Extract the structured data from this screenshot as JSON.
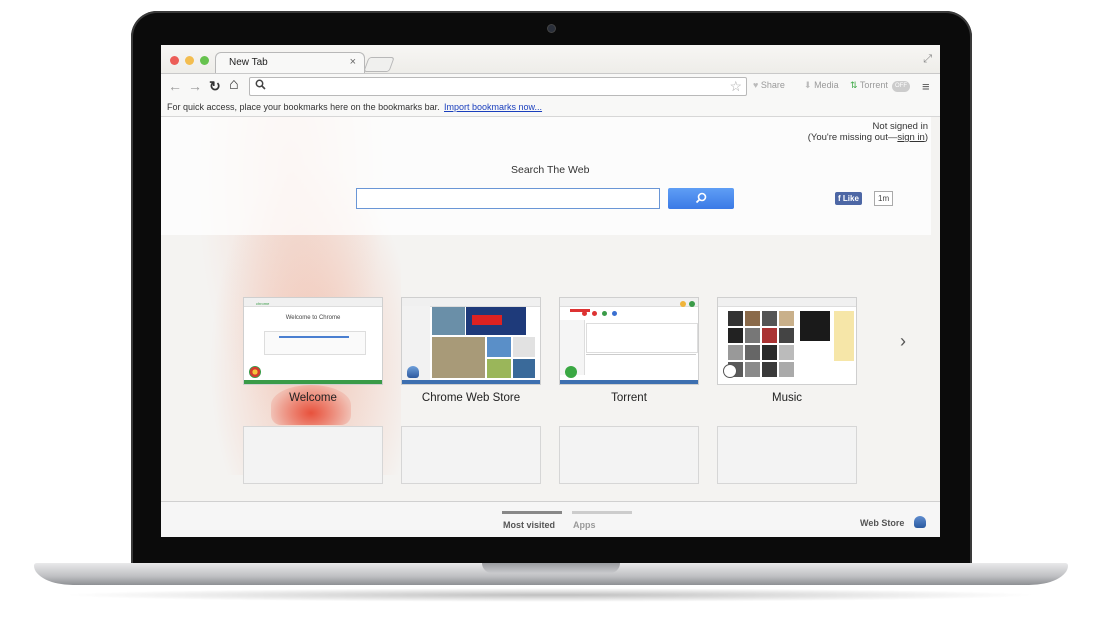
{
  "browser": {
    "tab_title": "New Tab",
    "tab_close": "×",
    "fullscreen_icon": "⤢",
    "back_icon": "←",
    "forward_icon": "→",
    "reload_icon": "↻",
    "home_icon": "⌂",
    "search_icon": "🔍",
    "omnibox_value": "",
    "star_icon": "☆",
    "share_label": "Share",
    "media_label": "Media",
    "torrent_label": "Torrent",
    "toggle_label": "OFF",
    "menu_icon": "≡"
  },
  "bookmarks_bar": {
    "text": "For quick access, place your bookmarks here on the bookmarks bar.",
    "link": "Import bookmarks now..."
  },
  "account": {
    "line1": "Not signed in",
    "line2_prefix": "(You're missing out—",
    "line2_link": "sign in",
    "line2_suffix": ")"
  },
  "search": {
    "title": "Search The Web",
    "placeholder": "",
    "button_icon": "⚲"
  },
  "facebook": {
    "like": "Like",
    "count": "1m"
  },
  "most_visited": [
    {
      "label": "Welcome",
      "accent": "#3a9b48"
    },
    {
      "label": "Chrome Web Store",
      "accent": "#3d6fb0"
    },
    {
      "label": "Torrent",
      "accent": "#3d6fb0"
    },
    {
      "label": "Music",
      "accent": "#e6e6e6"
    }
  ],
  "thumb_text": {
    "welcome_heading": "Welcome to Chrome",
    "chrome_brand": "chrome"
  },
  "next_icon": "›",
  "bottom_bar": {
    "most_visited": "Most visited",
    "apps": "Apps",
    "web_store": "Web Store"
  },
  "colors": {
    "accent_blue": "#3b7ae6",
    "facebook_blue": "#4d67a5",
    "link_blue": "#1a3fbd"
  }
}
